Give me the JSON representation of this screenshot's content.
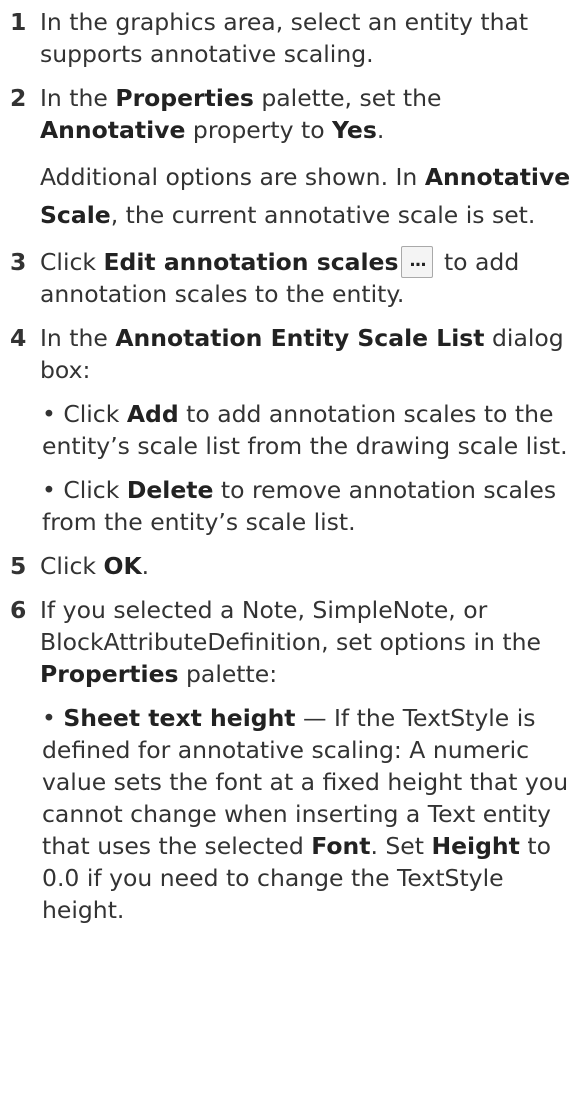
{
  "steps": [
    {
      "num": "1",
      "p1": {
        "t1": "In the graphics area, select an entity that supports annotative scaling."
      }
    },
    {
      "num": "2",
      "p1": {
        "t1": "In the ",
        "b1": "Properties",
        "t2": " palette, set the ",
        "b2": "Annotative",
        "t3": " property to ",
        "b3": "Yes",
        "t4": "."
      },
      "p2": {
        "t1": "Additional options are shown. In ",
        "b1": "Annotative Scale",
        "t2": ", the current annotative scale is set."
      }
    },
    {
      "num": "3",
      "p1": {
        "t1": "Click ",
        "b1": "Edit annotation scales",
        "button_glyph": "...",
        "t2": " to add annotation scales to the entity."
      }
    },
    {
      "num": "4",
      "p1": {
        "t1": "In the ",
        "b1": "Annotation Entity Scale List",
        "t2": " dialog box:"
      },
      "bullets": [
        {
          "t1": "• Click ",
          "b1": "Add",
          "t2": " to add annotation scales to the entity’s scale list from the drawing scale list."
        },
        {
          "t1": "• Click ",
          "b1": "Delete",
          "t2": " to remove annotation scales from the entity’s scale list."
        }
      ]
    },
    {
      "num": "5",
      "p1": {
        "t1": "Click ",
        "b1": "OK",
        "t2": "."
      }
    },
    {
      "num": "6",
      "p1": {
        "t1": "If you selected a Note, SimpleNote, or BlockAttributeDefinition, set options in the ",
        "b1": "Properties",
        "t2": " palette:"
      },
      "bullets": [
        {
          "t1": "• ",
          "b1": "Sheet text height",
          "t2": " — If the TextStyle is defined for annotative scaling: A numeric value sets the font at a fixed height that you cannot change when inserting a Text entity that uses the selected ",
          "b2": "Font",
          "t3": ". Set ",
          "b3": "Height",
          "t4": " to 0.0 if you need to change the TextStyle height."
        }
      ]
    }
  ]
}
